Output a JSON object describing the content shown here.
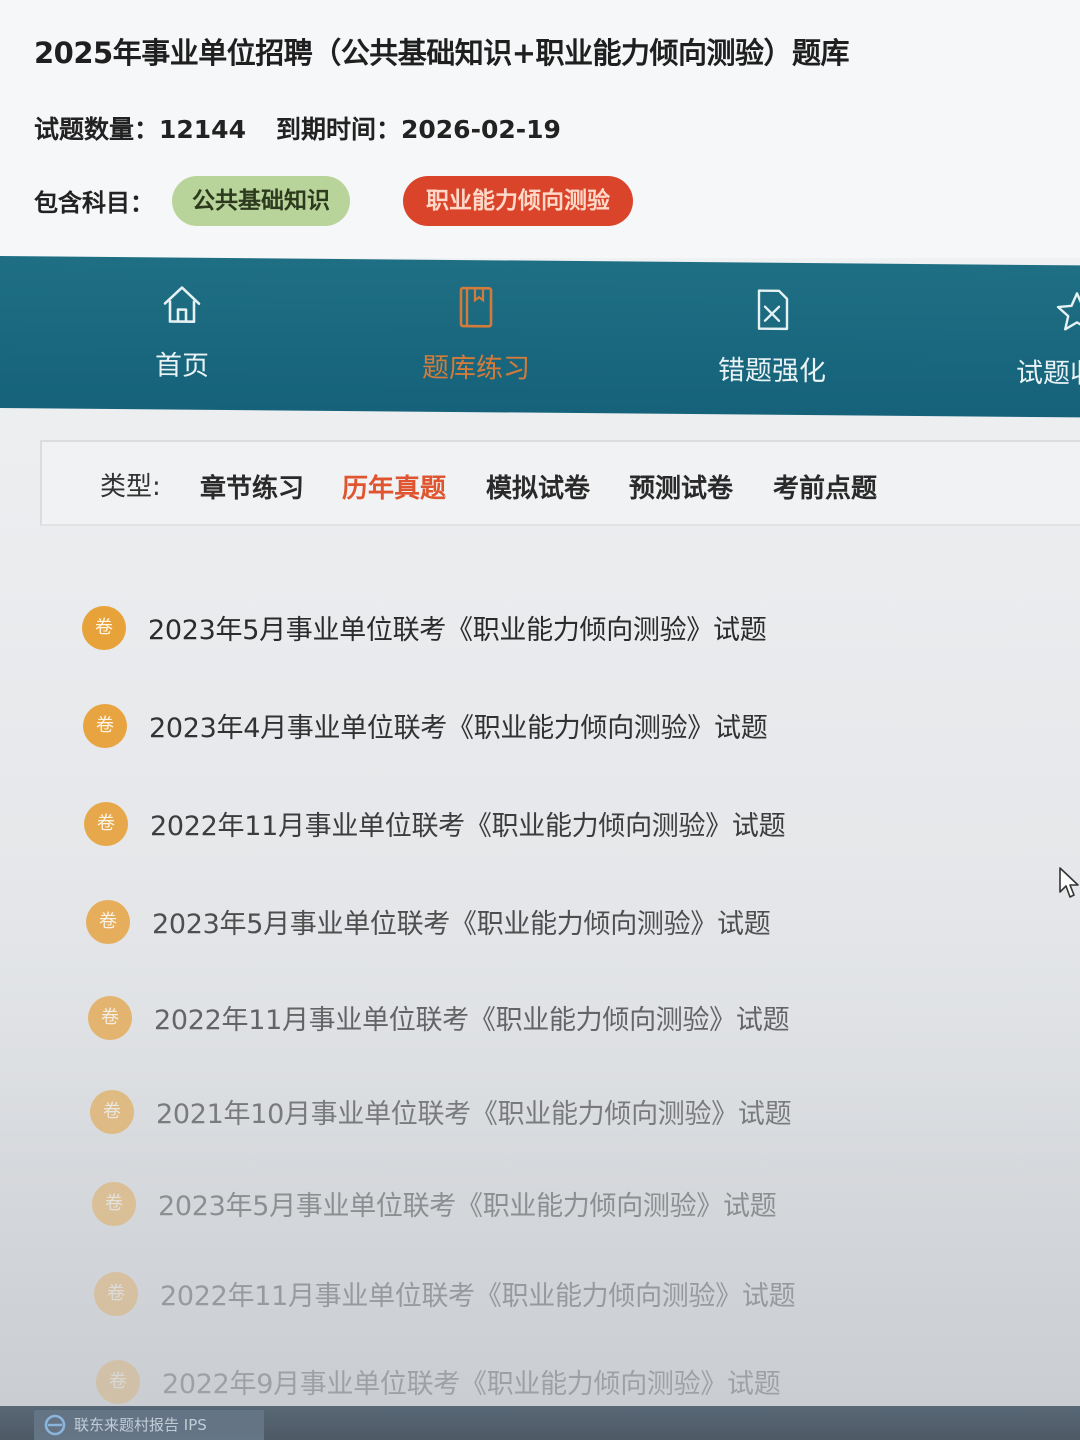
{
  "header": {
    "title": "2025年事业单位招聘（公共基础知识+职业能力倾向测验）题库",
    "question_count": "试题数量：12144",
    "expire_date": "到期时间：2026-02-19",
    "subjects_label": "包含科目：",
    "subjects": [
      "公共基础知识",
      "职业能力倾向测验"
    ]
  },
  "nav": {
    "items": [
      {
        "label": "首页",
        "icon": "home-icon",
        "active": false
      },
      {
        "label": "题库练习",
        "icon": "book-icon",
        "active": true
      },
      {
        "label": "错题强化",
        "icon": "wrong-question-icon",
        "active": false
      },
      {
        "label": "试题收",
        "icon": "star-icon",
        "active": false
      }
    ]
  },
  "types": {
    "label": "类型:",
    "tabs": [
      "章节练习",
      "历年真题",
      "模拟试卷",
      "预测试卷",
      "考前点题"
    ],
    "active_index": 1
  },
  "papers": {
    "badge": "卷",
    "items": [
      "2023年5月事业单位联考《职业能力倾向测验》试题",
      "2023年4月事业单位联考《职业能力倾向测验》试题",
      "2022年11月事业单位联考《职业能力倾向测验》试题",
      "2023年5月事业单位联考《职业能力倾向测验》试题",
      "2022年11月事业单位联考《职业能力倾向测验》试题",
      "2021年10月事业单位联考《职业能力倾向测验》试题",
      "2023年5月事业单位联考《职业能力倾向测验》试题",
      "2022年11月事业单位联考《职业能力倾向测验》试题",
      "2022年9月事业单位联考《职业能力倾向测验》试题"
    ]
  },
  "taskbar": {
    "app_label": "联东来题村报告 IPS"
  },
  "colors": {
    "nav_bg": "#1a6a80",
    "active_orange": "#d37b3a",
    "active_tab_red": "#e05530",
    "badge_orange": "#e8a23a",
    "chip_green": "#b9d49a",
    "chip_red": "#d9442a"
  }
}
